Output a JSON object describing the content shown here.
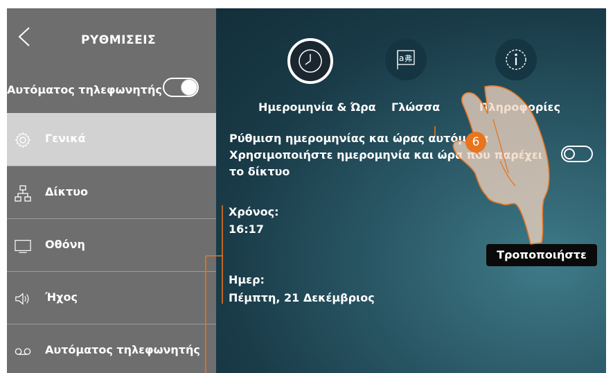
{
  "colors": {
    "sidebar_bg": "#6e6e6e",
    "sidebar_active_bg": "#d2d2d2",
    "main_bg_dark": "#132f3a",
    "accent_orange": "#e8741e",
    "button_bg": "#0a0a0a"
  },
  "sidebar": {
    "back_icon": "chevron-left-icon",
    "title": "ΡΥΘΜΙΣΕΙΣ",
    "answering_machine_label": "Αυτόματος τηλεφωνητής",
    "answering_machine_toggle": "on",
    "items": [
      {
        "label": "Γενικά",
        "icon": "gear-icon",
        "active": true
      },
      {
        "label": "Δίκτυο",
        "icon": "network-icon",
        "active": false
      },
      {
        "label": "Οθόνη",
        "icon": "monitor-icon",
        "active": false
      },
      {
        "label": "Ήχος",
        "icon": "speaker-icon",
        "active": false
      },
      {
        "label": "Αυτόματος τηλεφωνητής",
        "icon": "voicemail-icon",
        "active": false
      }
    ]
  },
  "tabs": [
    {
      "label": "Ημερομηνία & Ώρα",
      "icon": "clock-icon",
      "active": true
    },
    {
      "label": "Γλώσσα",
      "icon": "language-icon",
      "active": false
    },
    {
      "label": "Πληροφορίες",
      "icon": "info-icon",
      "active": false
    }
  ],
  "datetime": {
    "auto_line1": "Ρύθμιση ημερομηνίας και ώρας αυτόματα",
    "auto_line2": "Χρησιμοποιήστε ημερομηνία και ώρα που παρέχει",
    "auto_line3": "το δίκτυο",
    "auto_toggle": "off",
    "time_label": "Χρόνος:",
    "time_value": "16:17",
    "date_label": "Ημερ:",
    "date_value": "Πέμπτη, 21 Δεκέμβριος",
    "modify_button": "Τροποποιήστε"
  },
  "annotation": {
    "step_number": "6",
    "hand_icon": "pointing-hand-icon"
  }
}
